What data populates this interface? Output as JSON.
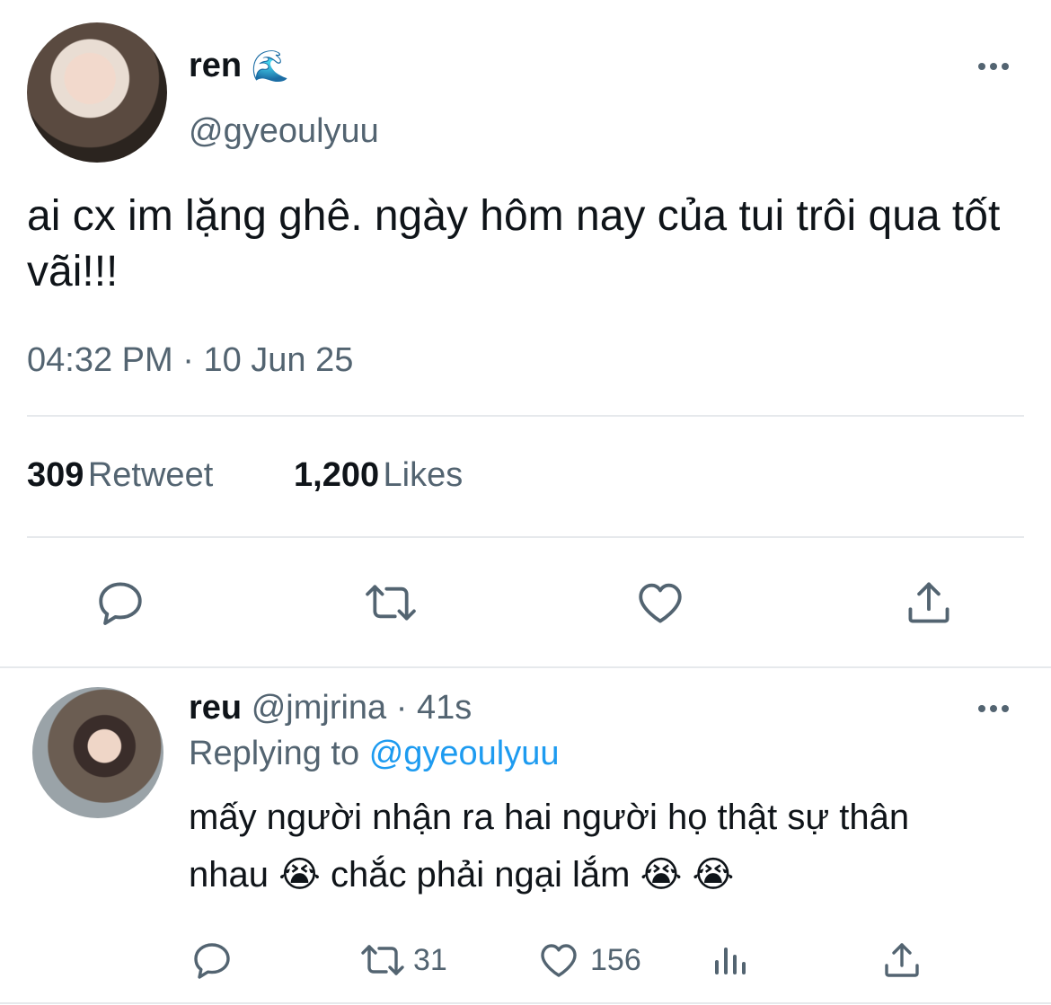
{
  "tweet": {
    "author_name": "ren",
    "author_emoji": "🌊",
    "author_handle": "@gyeoulyuu",
    "text": "ai cx im lặng ghê. ngày hôm nay của tui trôi qua tốt vãi!!!",
    "time": "04:32 PM",
    "sep": "·",
    "date": "10 Jun 25",
    "retweets": "309",
    "retweets_label": "Retweet",
    "likes": "1,200",
    "likes_label": "Likes"
  },
  "reply": {
    "author_name": "reu",
    "author_handle": "@jmjrina",
    "sep": "·",
    "age": "41s",
    "replying_label": "Replying to",
    "replying_handle": "@gyeoulyuu",
    "text": "mấy người nhận ra hai người họ thật sự thân nhau 😭  chắc phải ngại lắm 😭 😭",
    "retweet_count": "31",
    "like_count": "156"
  },
  "icons": {
    "reply": "speech-bubble-icon",
    "retweet": "retweet-icon",
    "like": "heart-icon",
    "share": "share-icon",
    "views": "bar-chart-icon",
    "more": "more-dots-icon"
  },
  "colors": {
    "text": "#0f1419",
    "secondary": "#536471",
    "link": "#1d9bf0",
    "divider": "#e6e9ec"
  }
}
